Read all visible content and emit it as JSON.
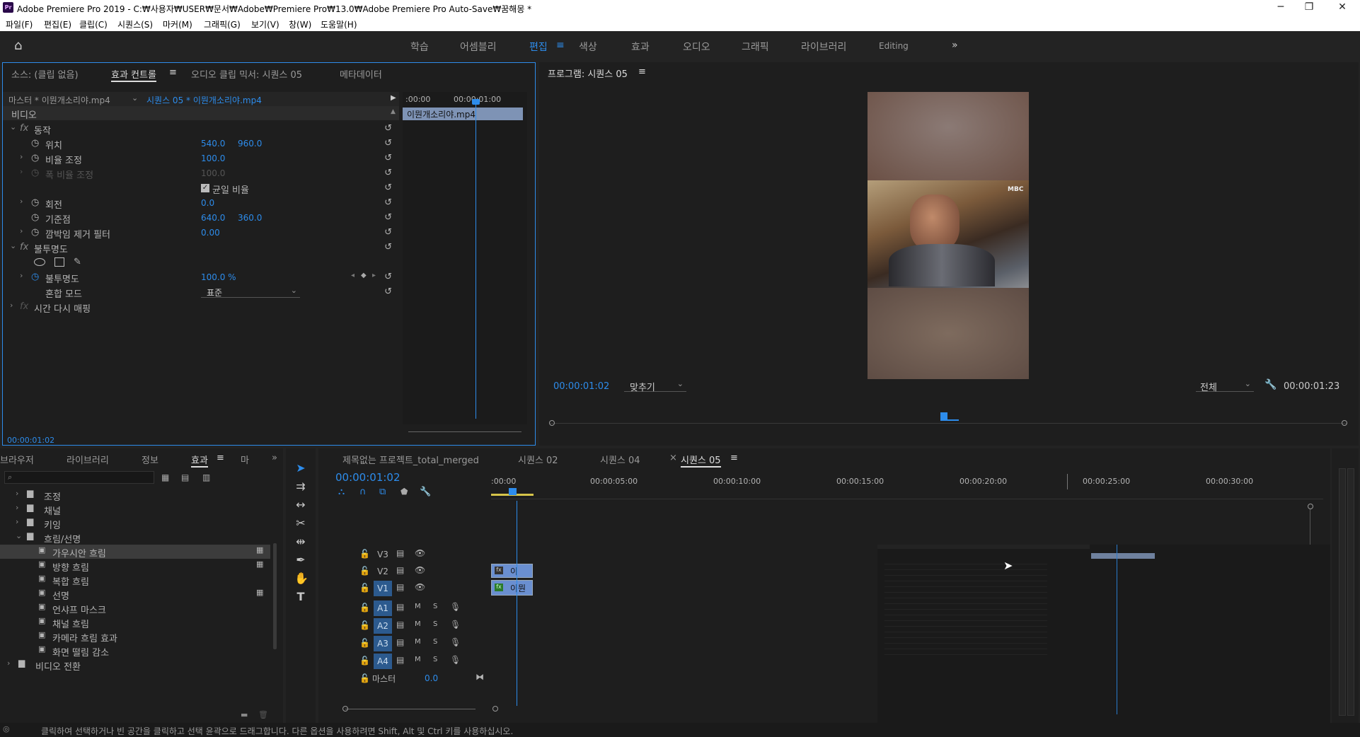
{
  "titlebar": {
    "title": "Adobe Premiere Pro 2019 - C:₩사용자₩USER₩문서₩Adobe₩Premiere Pro₩13.0₩Adobe Premiere Pro Auto-Save₩꿈해몽 *",
    "logo": "Pr",
    "minimize": "─",
    "maximize": "❐",
    "close": "✕"
  },
  "menu": [
    "파일(F)",
    "편집(E)",
    "클립(C)",
    "시퀀스(S)",
    "마커(M)",
    "그래픽(G)",
    "보기(V)",
    "창(W)",
    "도움말(H)"
  ],
  "workspaces": {
    "items": [
      "학습",
      "어셈블리",
      "편집",
      "색상",
      "효과",
      "오디오",
      "그래픽",
      "라이브러리",
      "Editing"
    ],
    "active": "편집",
    "more": "»"
  },
  "source_panel": {
    "tabs": [
      "소스: (클립 없음)",
      "효과 컨트롤",
      "오디오 클립 믹서: 시퀀스 05",
      "메타데이터"
    ],
    "master": "마스터 * 이뭔개소리야.mp4",
    "sequence": "시퀀스 05 * 이뭔개소리야.mp4",
    "section_video": "비디오",
    "clip_name": "이뭔개소리야.mp4",
    "mini_time0": ":00:00",
    "mini_time1": "00:00:01:00",
    "timecode": "00:00:01:02",
    "motion": "동작",
    "position": "위치",
    "pos_x": "540.0",
    "pos_y": "960.0",
    "scale": "비율 조정",
    "scale_val": "100.0",
    "scale_w": "폭 비율 조정",
    "scale_w_val": "100.0",
    "uniform": "균일 비율",
    "rotation": "회전",
    "rot_val": "0.0",
    "anchor": "기준점",
    "anc_x": "640.0",
    "anc_y": "360.0",
    "flicker": "깜박임 제거 필터",
    "flicker_val": "0.00",
    "opacity_section": "불투명도",
    "opacity": "불투명도",
    "opacity_val": "100.0 %",
    "blend": "혼합 모드",
    "blend_val": "표준",
    "time_remap": "시간 다시 매핑"
  },
  "program": {
    "title": "프로그램: 시퀀스 05",
    "timecode": "00:00:01:02",
    "fit": "맞추기",
    "quality": "전체",
    "duration": "00:00:01:23",
    "watermark": "MBC"
  },
  "effects_panel": {
    "tabs": [
      "브라우저",
      "라이브러리",
      "정보",
      "효과",
      "마"
    ],
    "folders": [
      "조정",
      "채널",
      "키잉",
      "흐림/선명"
    ],
    "items": [
      "가우시안 흐림",
      "방향 흐림",
      "복합 흐림",
      "선명",
      "언샤프 마스크",
      "채널 흐림",
      "카메라 흐림 효과",
      "화면 떨림 감소"
    ],
    "transition": "비디오 전환"
  },
  "timeline": {
    "tabs": [
      "제목없는 프로젝트_total_merged",
      "시퀀스 02",
      "시퀀스 04",
      "시퀀스 05"
    ],
    "timecode": "00:00:01:02",
    "ruler": [
      ":00:00",
      "00:00:05:00",
      "00:00:10:00",
      "00:00:15:00",
      "00:00:20:00",
      "00:00:25:00",
      "00:00:30:00"
    ],
    "video_tracks": [
      "V3",
      "V2",
      "V1"
    ],
    "audio_tracks": [
      "A1",
      "A2",
      "A3",
      "A4"
    ],
    "master": "마스터",
    "master_val": "0.0",
    "clip_v2": "이",
    "clip_v1": "이뭔",
    "m": "M",
    "s": "S"
  },
  "status": "클릭하여 선택하거나 빈 공간을 클릭하고 선택 윤곽으로 드래그합니다. 다른 옵션을 사용하려면 Shift, Alt 및 Ctrl 키를 사용하십시오.",
  "colors": {
    "accent": "#2d8ceb",
    "panel_bg": "#1e1e1e",
    "clip": "#6a8fd0",
    "playhead": "#2d8ceb"
  }
}
